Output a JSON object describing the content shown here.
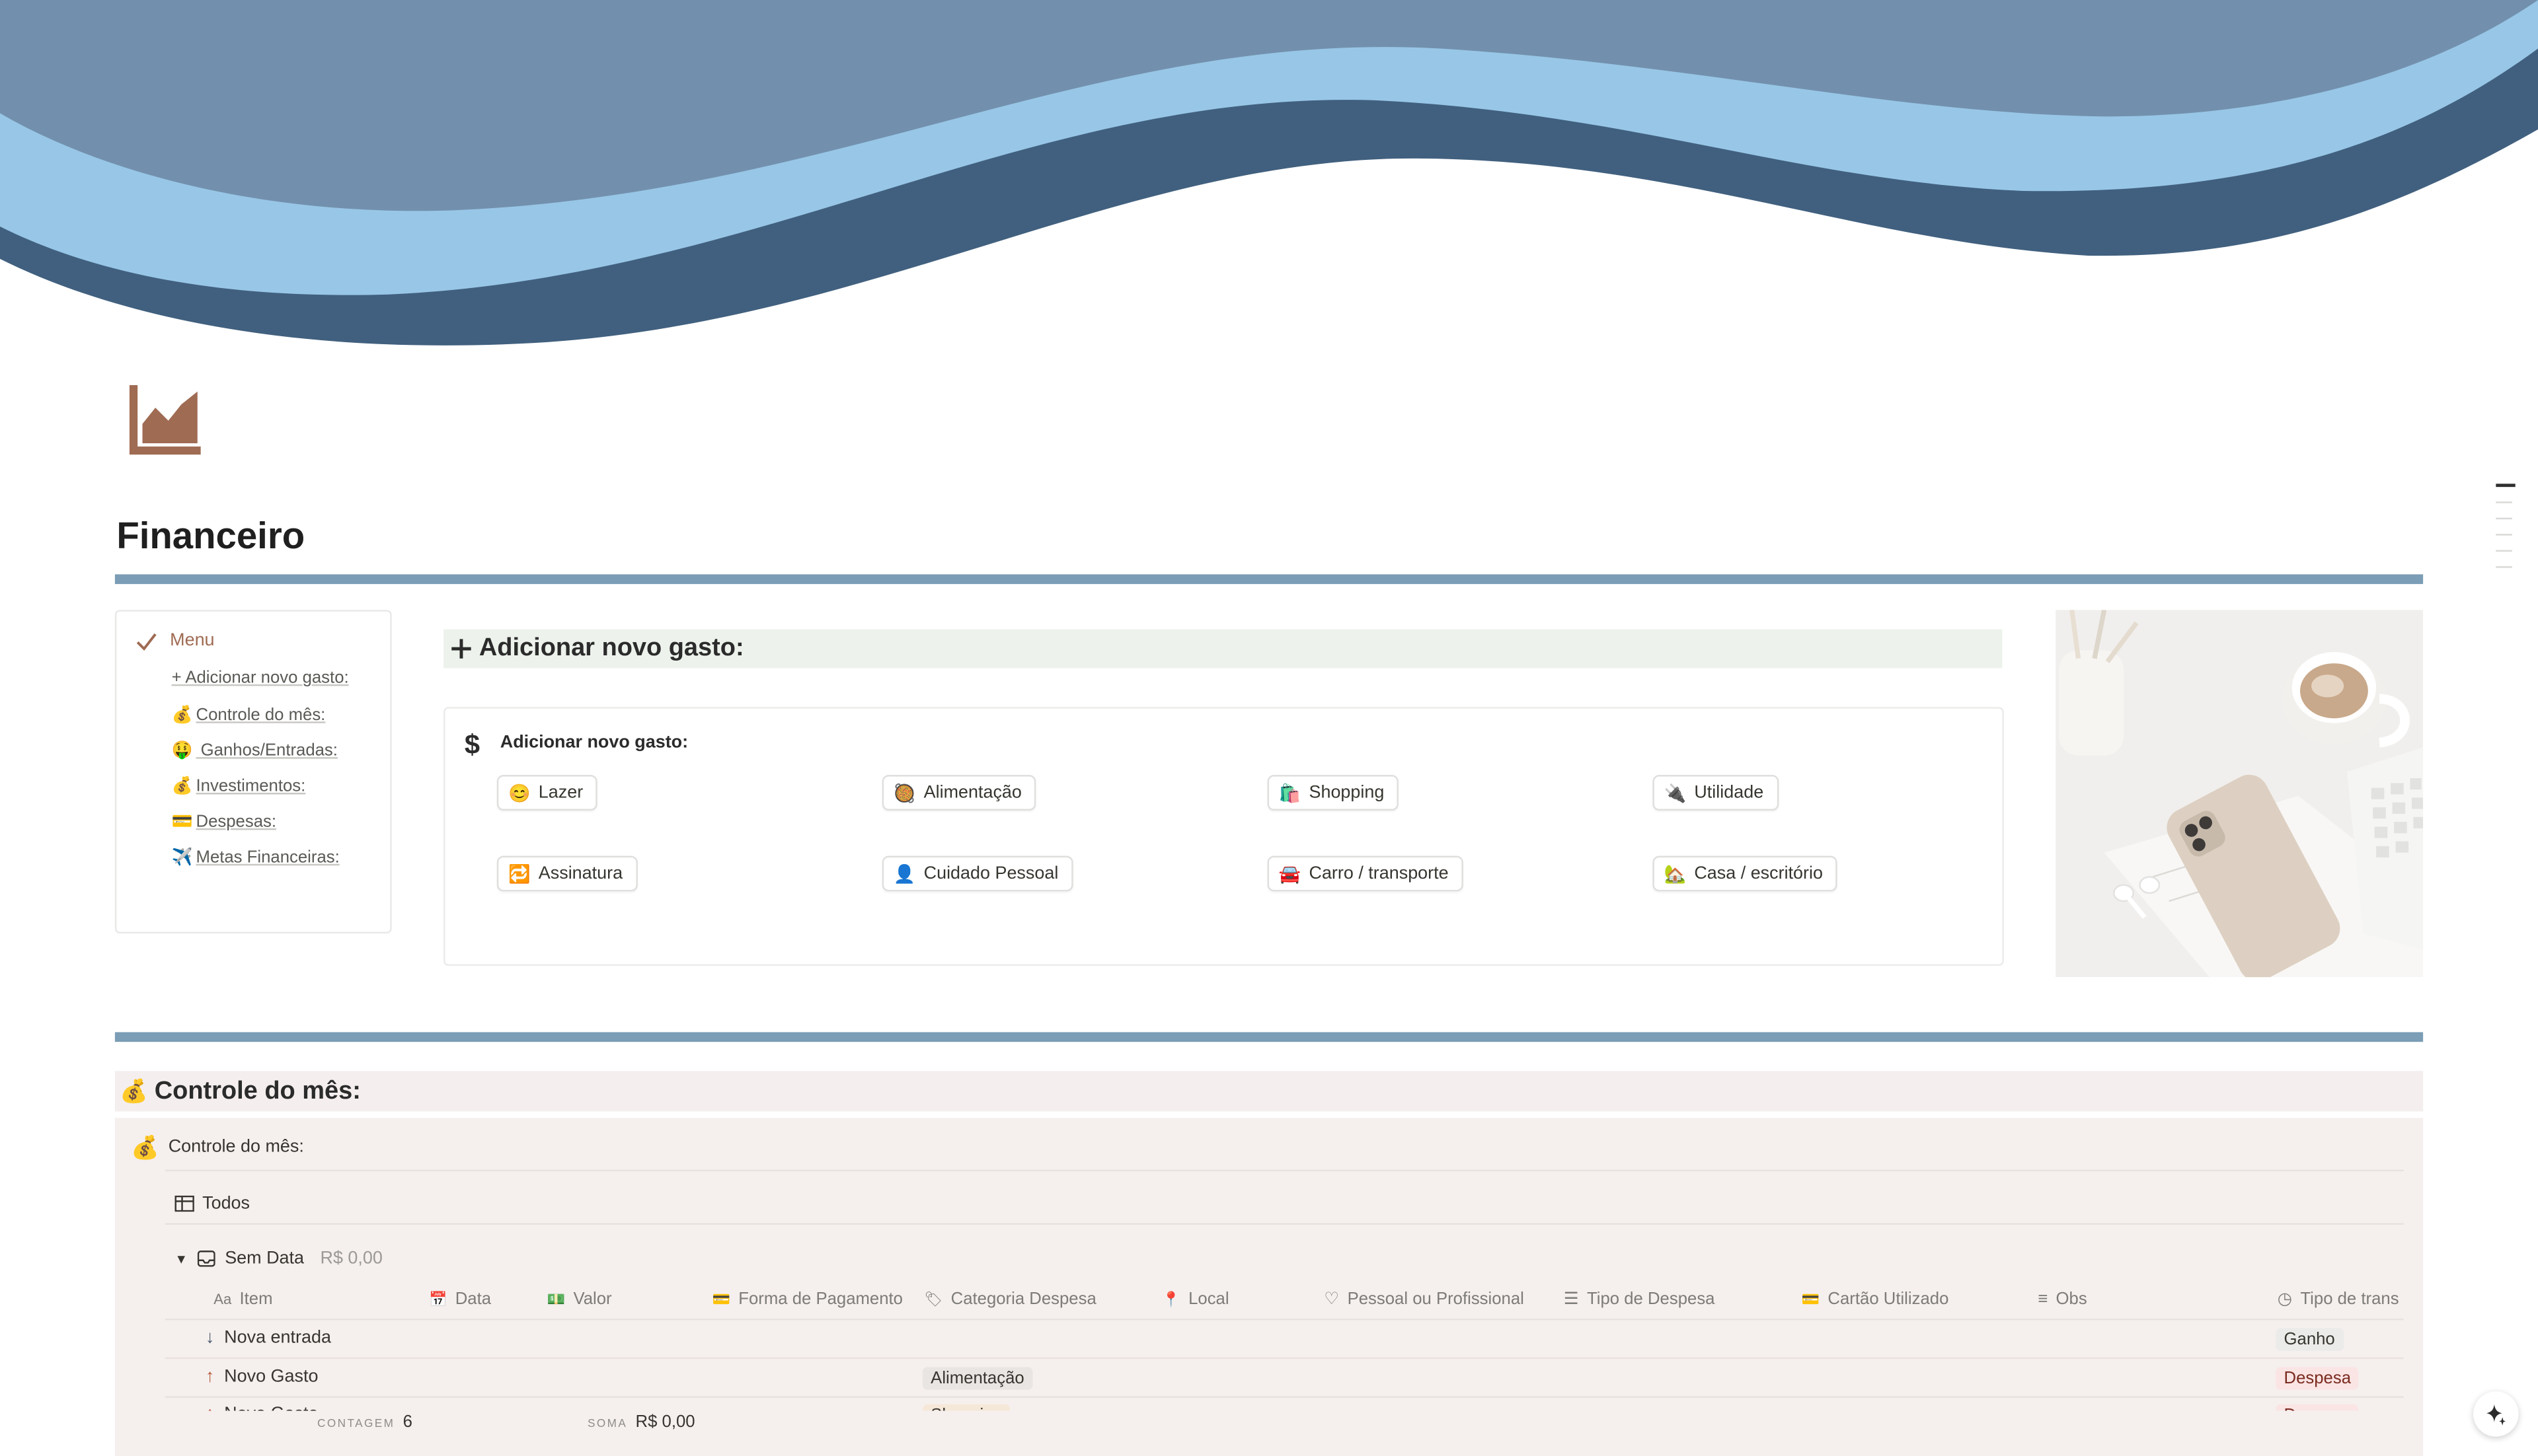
{
  "page": {
    "title": "Financeiro"
  },
  "menu": {
    "header": "Menu",
    "items": [
      {
        "emoji": "",
        "label": "+ Adicionar novo gasto:"
      },
      {
        "emoji": "💰",
        "label": "Controle do mês:"
      },
      {
        "emoji": "🤑",
        "label": " Ganhos/Entradas:"
      },
      {
        "emoji": "💰",
        "label": "Investimentos:"
      },
      {
        "emoji": "💳",
        "label": "Despesas:"
      },
      {
        "emoji": "✈️",
        "label": "Metas Financeiras:"
      }
    ]
  },
  "add_section": {
    "heading": "Adicionar novo gasto:",
    "box_title": "Adicionar novo gasto:",
    "buttons": [
      {
        "emoji": "😊",
        "label": "Lazer"
      },
      {
        "emoji": "🥘",
        "label": "Alimentação"
      },
      {
        "emoji": "🛍️",
        "label": "Shopping"
      },
      {
        "emoji": "🔌",
        "label": "Utilidade"
      },
      {
        "emoji": "🔁",
        "label": "Assinatura"
      },
      {
        "emoji": "👤",
        "label": "Cuidado Pessoal"
      },
      {
        "emoji": "🚘",
        "label": "Carro / transporte"
      },
      {
        "emoji": "🏡",
        "label": "Casa / escritório"
      }
    ]
  },
  "control_section": {
    "emoji": "💰",
    "heading": "Controle do mês:",
    "db_title": "Controle do mês:",
    "view_tab": "Todos",
    "group": {
      "label": "Sem Data",
      "sum": "R$ 0,00"
    },
    "columns": [
      {
        "icon": "Aa",
        "label": "Item"
      },
      {
        "icon": "📅",
        "label": "Data"
      },
      {
        "icon": "💵",
        "label": "Valor"
      },
      {
        "icon": "💳",
        "label": "Forma de Pagamento"
      },
      {
        "icon": "🏷",
        "label": "Categoria Despesa"
      },
      {
        "icon": "📍",
        "label": "Local"
      },
      {
        "icon": "♡",
        "label": "Pessoal ou Profissional"
      },
      {
        "icon": "☰",
        "label": "Tipo de Despesa"
      },
      {
        "icon": "💳",
        "label": "Cartão Utilizado"
      },
      {
        "icon": "≡",
        "label": "Obs"
      },
      {
        "icon": "◷",
        "label": "Tipo de trans"
      }
    ],
    "rows": [
      {
        "arrow": "↓",
        "item": "Nova entrada",
        "categoria": "",
        "tipo": "Ganho"
      },
      {
        "arrow": "↑",
        "item": "Novo Gasto",
        "categoria": "Alimentação",
        "tipo": "Despesa"
      },
      {
        "arrow": "↑",
        "item": "Novo Gasto",
        "categoria": "Shopping",
        "tipo": "Despesa"
      }
    ],
    "footer": {
      "count_label": "CONTAGEM",
      "count_value": "6",
      "sum_label": "SOMA",
      "sum_value": "R$ 0,00"
    }
  },
  "colors": {
    "cover_dark": "#41607f",
    "cover_mid": "#7290ad",
    "cover_light": "#98c6e6",
    "divider": "#7b9db5",
    "accent_brown": "#9f6b53",
    "ganho_tag": "#ebebe9",
    "despesa_tag": "#fbe4e4"
  }
}
